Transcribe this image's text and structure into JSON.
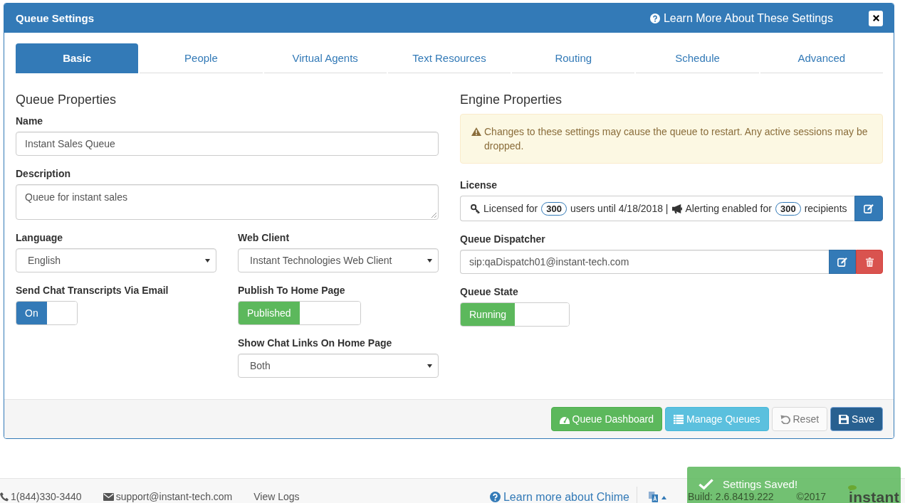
{
  "dialog": {
    "title": "Queue Settings",
    "help_link": "Learn More About These Settings"
  },
  "tabs": [
    {
      "label": "Basic",
      "selected": true
    },
    {
      "label": "People",
      "selected": false
    },
    {
      "label": "Virtual Agents",
      "selected": false
    },
    {
      "label": "Text Resources",
      "selected": false
    },
    {
      "label": "Routing",
      "selected": false
    },
    {
      "label": "Schedule",
      "selected": false
    },
    {
      "label": "Advanced",
      "selected": false
    }
  ],
  "queue_properties": {
    "heading": "Queue Properties",
    "name": {
      "label": "Name",
      "value": "Instant Sales Queue"
    },
    "description": {
      "label": "Description",
      "value": "Queue for instant sales"
    },
    "language": {
      "label": "Language",
      "value": "English"
    },
    "web_client": {
      "label": "Web Client",
      "value": "Instant Technologies Web Client"
    },
    "send_transcripts": {
      "label": "Send Chat Transcripts Via Email",
      "on": true,
      "state_label": "On"
    },
    "publish": {
      "label": "Publish To Home Page",
      "on": true,
      "state_label": "Published"
    },
    "chat_links": {
      "label": "Show Chat Links On Home Page",
      "value": "Both"
    }
  },
  "engine_properties": {
    "heading": "Engine Properties",
    "warning": "Changes to these settings may cause the queue to restart. Any active sessions may be dropped.",
    "license": {
      "label": "License",
      "licensed_for": "Licensed for",
      "users": "300",
      "users_until": "users until 4/18/2018 |",
      "alerting": "Alerting enabled for",
      "recipients": "300",
      "recipients_label": "recipients"
    },
    "dispatcher": {
      "label": "Queue Dispatcher",
      "value": "sip:qaDispatch01@instant-tech.com"
    },
    "queue_state": {
      "label": "Queue State",
      "on": true,
      "state_label": "Running"
    }
  },
  "actions": [
    {
      "label": "Queue Dashboard",
      "kind": "dashboard",
      "disabled": false
    },
    {
      "label": "Manage Queues",
      "kind": "list",
      "disabled": false
    },
    {
      "label": "Reset",
      "kind": "reset",
      "disabled": true
    },
    {
      "label": "Save",
      "kind": "save",
      "disabled": false
    }
  ],
  "footer": {
    "phone": "1(844)330-3440",
    "email": "support@instant-tech.com",
    "view_logs": "View Logs",
    "learn_more": "Learn more about Chime",
    "build": "Build: 2.6.8419.222",
    "copyright": "©2017",
    "logo": "instant"
  },
  "toast": {
    "message": "Settings Saved!"
  }
}
